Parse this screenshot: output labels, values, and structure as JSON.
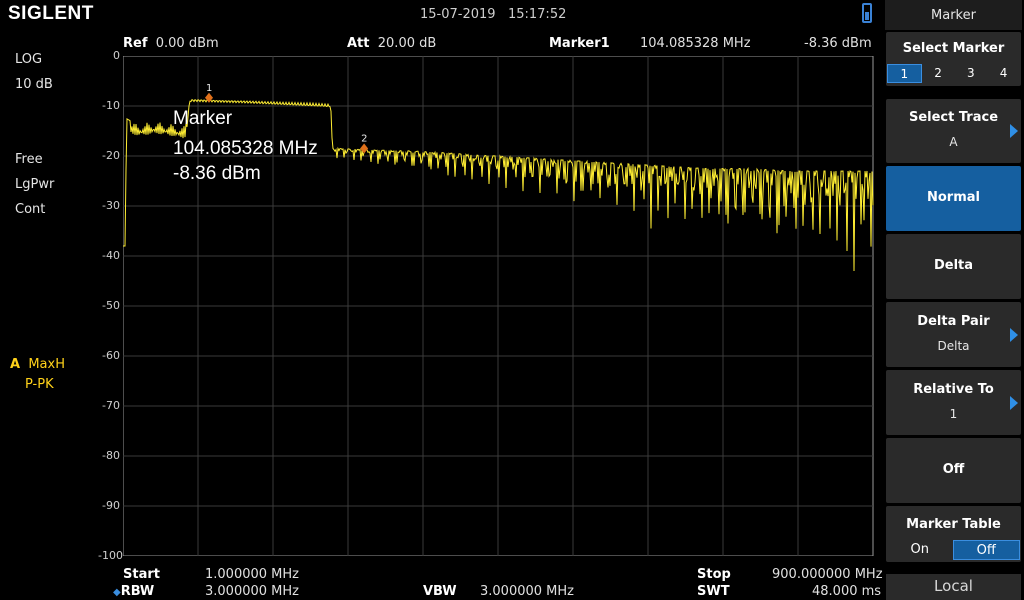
{
  "brand": "SIGLENT",
  "status": {
    "date": "15-07-2019",
    "time": "15:17:52"
  },
  "header": {
    "ref_label": "Ref",
    "ref_value": "0.00 dBm",
    "att_label": "Att",
    "att_value": "20.00 dB",
    "marker_label": "Marker1",
    "marker_freq": "104.085328 MHz",
    "marker_level": "-8.36 dBm"
  },
  "left": {
    "scale_type": "LOG",
    "scale_div": "10 dB",
    "mode1": "Free",
    "mode2": "LgPwr",
    "mode3": "Cont",
    "trace_letter": "A",
    "trace_mode": "MaxH",
    "detector": "P-PK"
  },
  "marker_box": {
    "title": "Marker",
    "freq": "104.085328 MHz",
    "level": "-8.36 dBm"
  },
  "markers": [
    {
      "label": "1",
      "freq_mhz": 104.085328,
      "level_dbm": -8.36
    },
    {
      "label": "2",
      "freq_mhz": 290,
      "level_dbm": -18.5
    }
  ],
  "bottom": {
    "start_label": "Start",
    "start_value": "1.000000 MHz",
    "stop_label": "Stop",
    "stop_value": "900.000000 MHz",
    "rbw_label": "RBW",
    "rbw_value": "3.000000 MHz",
    "vbw_label": "VBW",
    "vbw_value": "3.000000 MHz",
    "swt_label": "SWT",
    "swt_value": "48.000 ms"
  },
  "menu": {
    "title": "Marker",
    "select_marker": "Select Marker",
    "marker_numbers": [
      "1",
      "2",
      "3",
      "4"
    ],
    "selected_marker": "1",
    "select_trace": "Select Trace",
    "select_trace_value": "A",
    "normal": "Normal",
    "delta": "Delta",
    "delta_pair": "Delta Pair",
    "delta_pair_value": "Delta",
    "relative_to": "Relative To",
    "relative_to_value": "1",
    "off": "Off",
    "marker_table": "Marker Table",
    "table_on": "On",
    "table_off": "Off",
    "local": "Local"
  },
  "chart_data": {
    "type": "line",
    "xlim": [
      1,
      900
    ],
    "ylim": [
      -100,
      0
    ],
    "yticks": [
      0,
      -10,
      -20,
      -30,
      -40,
      -50,
      -60,
      -70,
      -80,
      -90,
      -100
    ],
    "grid": true,
    "trace_color": "#ffee33",
    "series": [
      {
        "x": [
          1,
          4,
          5,
          10,
          20,
          40,
          60,
          75,
          82,
          90,
          110,
          150,
          200,
          240,
          250,
          252,
          260,
          300,
          350,
          400,
          420,
          450,
          500,
          550,
          600,
          650,
          700,
          750,
          800,
          850,
          900
        ],
        "values": [
          -38,
          -38,
          -12.5,
          -13,
          -13.5,
          -13,
          -13.5,
          -14,
          -8.5,
          -8.5,
          -8.6,
          -8.8,
          -9.2,
          -9.5,
          -9.6,
          -18.5,
          -18.5,
          -18.8,
          -19,
          -19.5,
          -19.8,
          -20,
          -20.5,
          -21,
          -21.5,
          -22,
          -22.5,
          -22.5,
          -23,
          -23,
          -23
        ]
      }
    ]
  }
}
